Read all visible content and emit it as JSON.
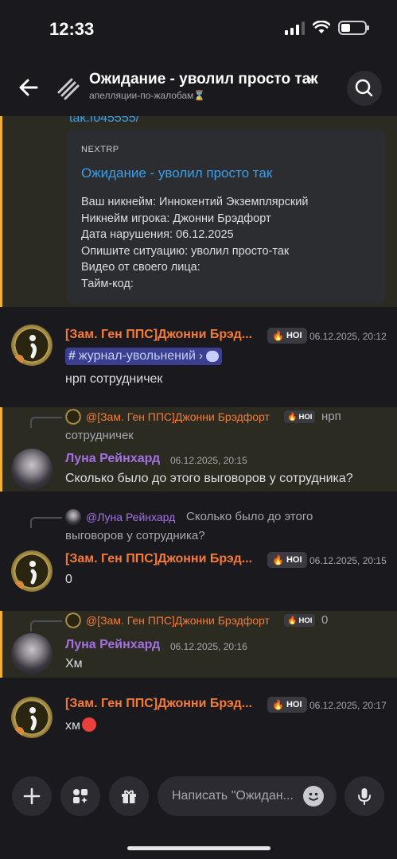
{
  "status": {
    "time": "12:33"
  },
  "header": {
    "title": "Ожидание - уволил просто так",
    "subtitle": "апелляции-по-жалобам⌛"
  },
  "first": {
    "link_fragment": "tak.f045555/",
    "embed": {
      "provider": "NEXTRP",
      "title": "Ожидание - уволил просто так",
      "lines": [
        "Ваш никнейм: Иннокентий Экземплярский",
        "Никнейм игрока: Джонни Брэдфорт",
        "Дата нарушения: 06.12.2025",
        "Опишите ситуацию: уволил просто-так",
        "Видео от своего лица:",
        "Тайм-код:"
      ]
    }
  },
  "messages": [
    {
      "author": "[Зам. Ген ППС]Джонни Брэд...",
      "badge": "НОІ",
      "time": "06.12.2025, 20:12",
      "channel": "журнал-увольнений",
      "text": "нрп сотрудничек"
    },
    {
      "reply_name": "@[Зам. Ген ППС]Джонни Брэдфорт",
      "reply_badge": "НОІ",
      "reply_text_1": "нрп",
      "reply_text_2": "сотрудничек",
      "author": "Луна Рейнхард",
      "time": "06.12.2025, 20:15",
      "text": "Сколько было до этого выговоров у сотрудника?"
    },
    {
      "reply_name": "@Луна Рейнхард",
      "reply_text_1": "Сколько было до этого",
      "reply_text_2": "выговоров у сотрудника?",
      "author": "[Зам. Ген ППС]Джонни Брэд...",
      "badge": "НОІ",
      "time": "06.12.2025, 20:15",
      "text": "0"
    },
    {
      "reply_name": "@[Зам. Ген ППС]Джонни Брэдфорт",
      "reply_badge": "НОІ",
      "reply_text_1": "0",
      "author": "Луна Рейнхард",
      "time": "06.12.2025, 20:16",
      "text": "Хм"
    },
    {
      "author": "[Зам. Ген ППС]Джонни Брэд...",
      "badge": "НОІ",
      "time": "06.12.2025, 20:17",
      "text": "хм"
    }
  ],
  "composer": {
    "placeholder": "Написать \"Ожидан..."
  },
  "colors": {
    "highlight_border": "#f0b132",
    "link": "#3c9fe8",
    "author_orange": "#f47b3a",
    "author_purple": "#a371e0"
  }
}
